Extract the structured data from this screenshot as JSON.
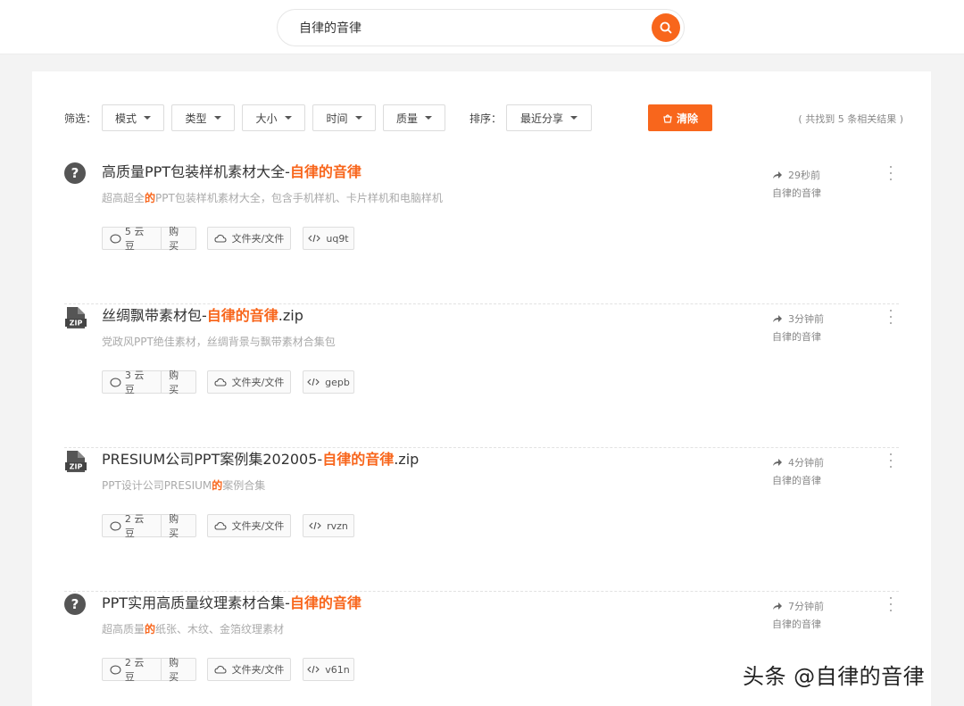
{
  "search": {
    "value": "自律的音律",
    "placeholder": ""
  },
  "filters": {
    "filter_label": "筛选：",
    "dropdowns": [
      "模式",
      "类型",
      "大小",
      "时间",
      "质量"
    ],
    "sort_label": "排序：",
    "sort_value": "最近分享",
    "clear_label": "清除",
    "result_count": "( 共找到 5 条相关结果 )"
  },
  "results": [
    {
      "icon": "question-icon",
      "title_pre": "高质量PPT包装样机素材大全-",
      "title_hl": "自律的音律",
      "title_post": "",
      "desc_pre": "超高超全",
      "desc_hl": "的",
      "desc_post": "PPT包装样机素材大全，包含手机样机、卡片样机和电脑样机",
      "price": "5 云豆",
      "buy": "购买",
      "folder": "文件夹/文件",
      "code": "uq9t",
      "time": "29秒前",
      "user": "自律的音律"
    },
    {
      "icon": "zip-icon",
      "title_pre": "丝绸飘带素材包-",
      "title_hl": "自律的音律",
      "title_post": ".zip",
      "desc_pre": "党政风PPT绝佳素材，丝绸背景与飘带素材合集包",
      "desc_hl": "",
      "desc_post": "",
      "price": "3 云豆",
      "buy": "购买",
      "folder": "文件夹/文件",
      "code": "gepb",
      "time": "3分钟前",
      "user": "自律的音律"
    },
    {
      "icon": "zip-icon",
      "title_pre": "PRESIUM公司PPT案例集202005-",
      "title_hl": "自律的音律",
      "title_post": ".zip",
      "desc_pre": "PPT设计公司PRESIUM",
      "desc_hl": "的",
      "desc_post": "案例合集",
      "price": "2 云豆",
      "buy": "购买",
      "folder": "文件夹/文件",
      "code": "rvzn",
      "time": "4分钟前",
      "user": "自律的音律"
    },
    {
      "icon": "question-icon",
      "title_pre": "PPT实用高质量纹理素材合集-",
      "title_hl": "自律的音律",
      "title_post": "",
      "desc_pre": "超高质量",
      "desc_hl": "的",
      "desc_post": "纸张、木纹、金箔纹理素材",
      "price": "2 云豆",
      "buy": "购买",
      "folder": "文件夹/文件",
      "code": "v61n",
      "time": "7分钟前",
      "user": "自律的音律"
    }
  ],
  "watermark": "头条 @自律的音律",
  "colors": {
    "accent": "#f8661c",
    "muted": "#aaaaaa"
  }
}
